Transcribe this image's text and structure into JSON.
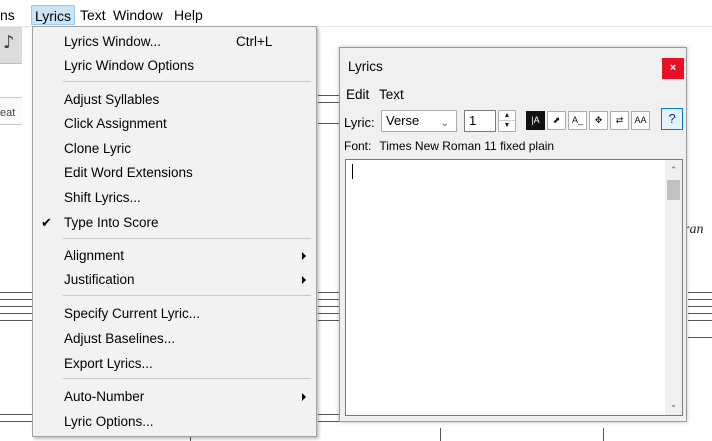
{
  "menubar": {
    "truncated": "ns",
    "lyrics": "Lyrics",
    "text": "Text",
    "window": "Window",
    "help": "Help"
  },
  "background": {
    "header_fragment": "eat",
    "italic_fragment": "ran"
  },
  "lyrics_menu": {
    "items": [
      {
        "label": "Lyrics Window...",
        "shortcut": "Ctrl+L"
      },
      {
        "label": "Lyric Window Options"
      },
      {
        "label": "Adjust Syllables"
      },
      {
        "label": "Click Assignment"
      },
      {
        "label": "Clone Lyric"
      },
      {
        "label": "Edit Word Extensions"
      },
      {
        "label": "Shift Lyrics..."
      },
      {
        "label": "Type Into Score",
        "checked": true
      },
      {
        "label": "Alignment",
        "submenu": true
      },
      {
        "label": "Justification",
        "submenu": true
      },
      {
        "label": "Specify Current Lyric..."
      },
      {
        "label": "Adjust Baselines..."
      },
      {
        "label": "Export Lyrics..."
      },
      {
        "label": "Auto-Number",
        "submenu": true
      },
      {
        "label": "Lyric Options..."
      }
    ],
    "check_glyph": "✔"
  },
  "lyrics_window": {
    "title": "Lyrics",
    "close_label": "×",
    "menu_edit": "Edit",
    "menu_text": "Text",
    "lyric_label": "Lyric:",
    "lyric_type": "Verse",
    "number": "1",
    "tool_icons": [
      "type-into-score-icon",
      "selection-arrow-icon",
      "lyric-extension-icon",
      "move-icon",
      "swap-icon",
      "font-size-icon"
    ],
    "help_label": "?",
    "font_label": "Font:",
    "font_value": "Times New Roman 11 fixed plain",
    "text_content": ""
  }
}
